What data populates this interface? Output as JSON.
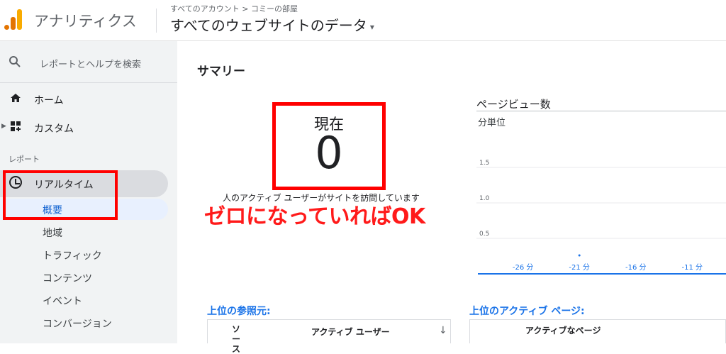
{
  "header": {
    "app_title": "アナリティクス",
    "breadcrumb": "すべてのアカウント > コミーの部屋",
    "view_name": "すべてのウェブサイトのデータ",
    "view_caret": "▾"
  },
  "sidebar": {
    "search_label": "レポートとヘルプを検索",
    "nav": [
      {
        "label": "ホーム"
      },
      {
        "label": "カスタム"
      }
    ],
    "reports_section": "レポート",
    "realtime_label": "リアルタイム",
    "sub_items": [
      {
        "label": "概要"
      },
      {
        "label": "地域"
      },
      {
        "label": "トラフィック"
      },
      {
        "label": "コンテンツ"
      },
      {
        "label": "イベント"
      },
      {
        "label": "コンバージョン"
      }
    ]
  },
  "main": {
    "summary_title": "サマリー",
    "current_label": "現在",
    "current_value": "0",
    "active_users_text": "人のアクティブ ユーザーがサイトを訪問しています",
    "annotation": "ゼロになっていればOK",
    "pageviews_title": "ページビュー数",
    "chart_unit": "分単位",
    "referrers_title": "上位の参照元:",
    "referrers_columns": [
      "ソース",
      "アクティブ ユーザー"
    ],
    "sort_icon": "↓",
    "active_pages_title": "上位のアクティブ ページ:",
    "active_pages_columns": [
      "アクティブなページ"
    ]
  },
  "colors": {
    "annotation_red": "#ff0000",
    "accent_blue": "#1a73e8",
    "chart_series": "#1a73e8"
  },
  "chart_data": {
    "type": "line",
    "title": "ページビュー数",
    "subtitle": "分単位",
    "x": [
      -30,
      -26,
      -21,
      -16,
      -11,
      -6
    ],
    "x_tick_labels": [
      "-26 分",
      "-21 分",
      "-16 分",
      "-11 分"
    ],
    "x_ticks": [
      -26,
      -21,
      -16,
      -11
    ],
    "series": [
      {
        "values": [
          0,
          0,
          0,
          0,
          0,
          0
        ]
      }
    ],
    "y_ticks": [
      0.5,
      1.0,
      1.5
    ],
    "y_tick_labels": [
      "0.5",
      "1.0",
      "1.5"
    ],
    "ylim": [
      0,
      2
    ],
    "xlim": [
      -30,
      -8
    ],
    "grid": true
  }
}
